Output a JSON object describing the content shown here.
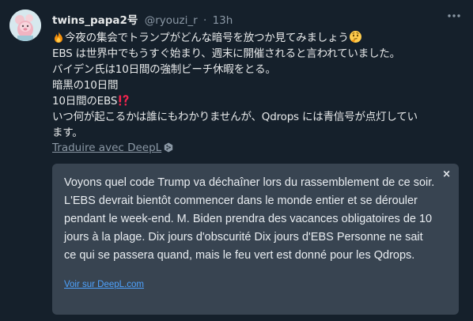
{
  "tweet": {
    "display_name": "twins_papa2号",
    "handle": "@ryouzi_r",
    "separator": "·",
    "time": "13h",
    "lines": [
      "今夜の集会でトランプがどんな暗号を放つか見てみましょう",
      "EBS は世界中でもうすぐ始まり、週末に開催されると言われていました。",
      "バイデン氏は10日間の強制ビーチ休暇をとる。",
      "暗黒の10日間",
      "10日間のEBS",
      "いつ何が起こるかは誰にもわかりませんが、Qdrops には青信号が点灯してい",
      "ます。"
    ],
    "translate_label": "Traduire avec DeepL",
    "icons": {
      "avatar": "avatar-image",
      "more": "more-options-icon",
      "fire": "fire-emoji-icon",
      "thinking": "thinking-face-emoji-icon",
      "interrobang": "interrobang-emoji-icon",
      "deepl": "deepl-logo-icon"
    }
  },
  "translation_popup": {
    "text": "Voyons quel code Trump va déchaîner lors du rassemblement de ce soir. L'EBS devrait bientôt commencer dans le monde entier et se dérouler pendant le week-end. M. Biden prendra des vacances obligatoires de 10 jours à la plage. Dix jours d'obscurité Dix jours d'EBS Personne ne sait ce qui se passera quand, mais le feu vert est donné pour les Qdrops.",
    "close_label": "×",
    "link_label": "Voir sur DeepL.com"
  },
  "colors": {
    "background": "#15202b",
    "text": "#e7e9ea",
    "secondary": "#8b98a5",
    "popup_bg": "#384451",
    "link": "#4ea3ff",
    "interrobang": "#f4244e"
  }
}
